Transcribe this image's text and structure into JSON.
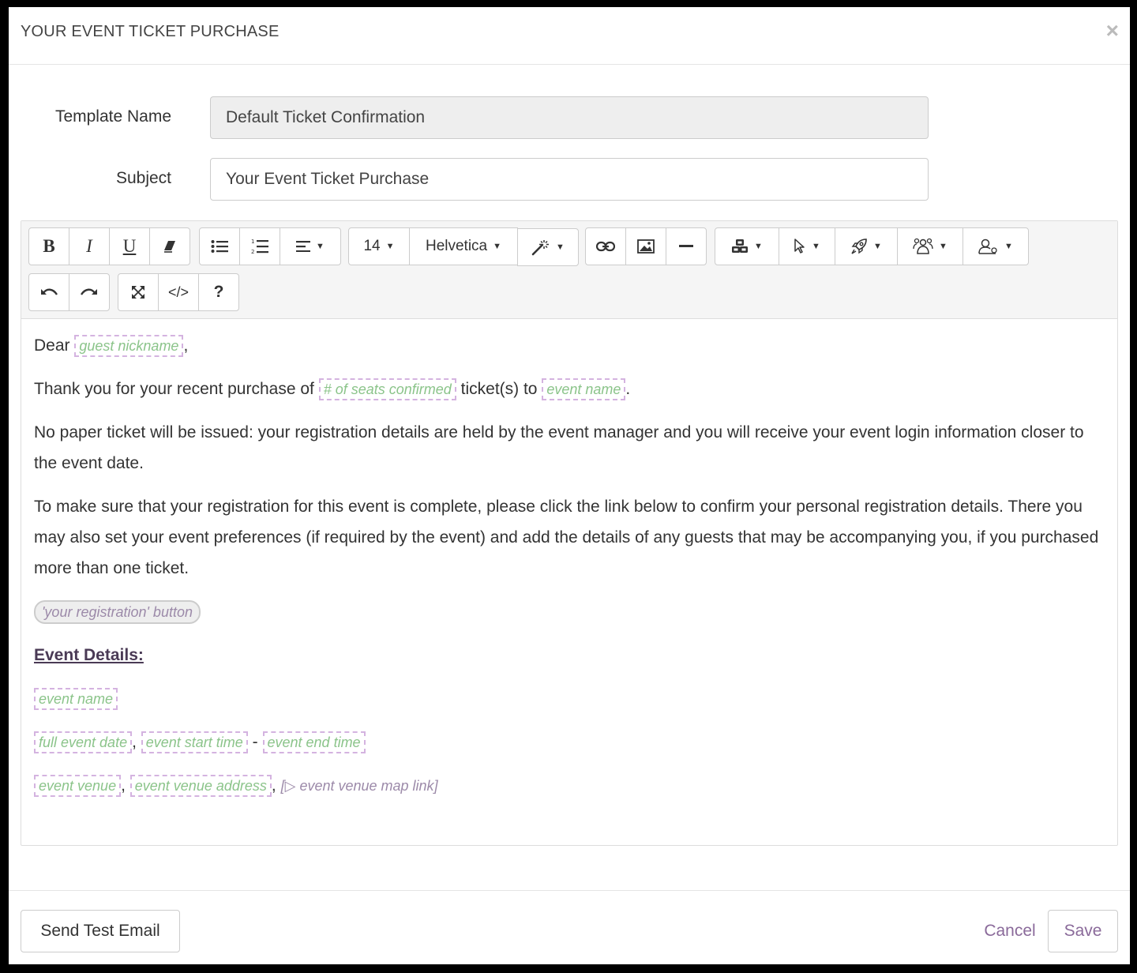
{
  "modal": {
    "title": "YOUR EVENT TICKET PURCHASE",
    "close": "×"
  },
  "form": {
    "template_name_label": "Template Name",
    "template_name_value": "Default Ticket Confirmation",
    "subject_label": "Subject",
    "subject_value": "Your Event Ticket Purchase"
  },
  "toolbar": {
    "bold": "B",
    "italic": "I",
    "underline": "U",
    "font_size": "14",
    "font_family": "Helvetica",
    "help": "?",
    "code": "</>",
    "icons": [
      "eraser-icon",
      "bullet-list-icon",
      "numbered-list-icon",
      "align-icon",
      "magic-wand-icon",
      "link-icon",
      "image-icon",
      "horizontal-rule-icon",
      "cubes-icon",
      "pointer-icon",
      "rocket-icon",
      "users-group-icon",
      "user-icon",
      "undo-icon",
      "redo-icon",
      "fullscreen-icon"
    ]
  },
  "content": {
    "dear": "Dear",
    "ph_guest_nickname": "guest nickname",
    "comma": ",",
    "thank_you": "Thank you for your recent purchase of",
    "ph_seats": "# of seats confirmed",
    "tickets_to": "ticket(s) to",
    "ph_event_name": "event name",
    "period": ".",
    "para_no_paper": "No paper ticket will be issued: your registration details are held by the event manager and you will receive your event login information closer to the event date.",
    "para_make_sure": "To make sure that your registration for this event is complete, please click the link below to confirm your personal registration details. There you may also set your event preferences (if required by the event) and add the details of any guests that may be accompanying you, if you purchased more than one ticket.",
    "ph_registration_button": "'your registration' button",
    "event_details_heading": "Event Details:",
    "ph_event_name_2": "event name",
    "ph_full_event_date": "full event date",
    "ph_event_start_time": "event start time",
    "dash": "-",
    "ph_event_end_time": "event end time",
    "ph_event_venue": "event venue",
    "ph_event_venue_address": "event venue address",
    "ph_event_venue_map_link": "event venue map link"
  },
  "footer": {
    "send_test": "Send Test Email",
    "cancel": "Cancel",
    "save": "Save"
  },
  "colors": {
    "placeholder_text": "#8bc48a",
    "placeholder_border": "#d4b3e0",
    "accent": "#8a6a9a"
  }
}
